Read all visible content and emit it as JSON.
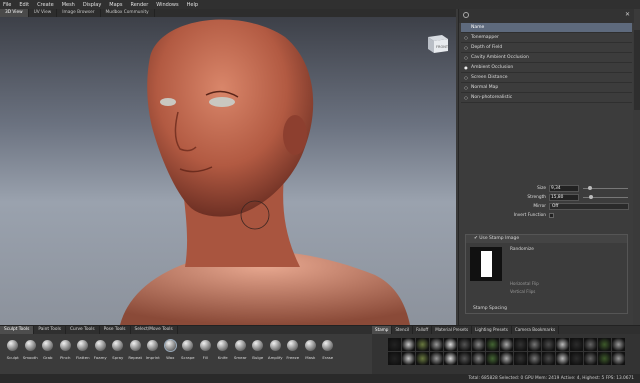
{
  "menu": [
    "File",
    "Edit",
    "Create",
    "Mesh",
    "Display",
    "Maps",
    "Render",
    "Windows",
    "Help"
  ],
  "tabs": [
    {
      "label": "3D View",
      "active": true
    },
    {
      "label": "UV View",
      "active": false
    },
    {
      "label": "Image Browser",
      "active": false
    },
    {
      "label": "Mudbox Community",
      "active": false
    }
  ],
  "viewcube_label": "FRONT",
  "filters": {
    "header": "Name",
    "items": [
      {
        "label": "Tonemapper",
        "checked": false
      },
      {
        "label": "Depth of Field",
        "checked": false
      },
      {
        "label": "Cavity Ambient Occlusion",
        "checked": false
      },
      {
        "label": "Ambient Occlusion",
        "checked": true
      },
      {
        "label": "Screen Distance",
        "checked": false
      },
      {
        "label": "Normal Map",
        "checked": false
      },
      {
        "label": "Non-photorealistic",
        "checked": false
      }
    ]
  },
  "properties": {
    "size": {
      "label": "Size",
      "value": "9,34"
    },
    "strength": {
      "label": "Strength",
      "value": "15,80"
    },
    "mirror": {
      "label": "Mirror",
      "value": "Off"
    },
    "invert": {
      "label": "Invert Function"
    }
  },
  "stamp": {
    "use_label": "Use Stamp Image",
    "randomize": "Randomize",
    "horizontal_flip": "Horizontal Flip",
    "vertical_flip": "Vertical Flips",
    "spacing": "Stamp Spacing"
  },
  "tool_tabs": [
    "Sculpt Tools",
    "Paint Tools",
    "Curve Tools",
    "Pose Tools",
    "Select/Move Tools"
  ],
  "tools": [
    "Sculpt",
    "Smooth",
    "Grab",
    "Pinch",
    "Flatten",
    "Foamy",
    "Spray",
    "Repeat",
    "Imprint",
    "Wax",
    "Scrape",
    "Fill",
    "Knife",
    "Smear",
    "Bulge",
    "Amplify",
    "Freeze",
    "Mask",
    "Erase"
  ],
  "active_tool": "Wax",
  "stamp_tabs": [
    "Stamp",
    "Stencil",
    "Falloff",
    "Material Presets",
    "Lighting Presets",
    "Camera Bookmarks"
  ],
  "status": "Total: 685828  Selected: 0  GPU Mem: 2419  Active: 4, Highest: 5  FPS: 13.0671"
}
